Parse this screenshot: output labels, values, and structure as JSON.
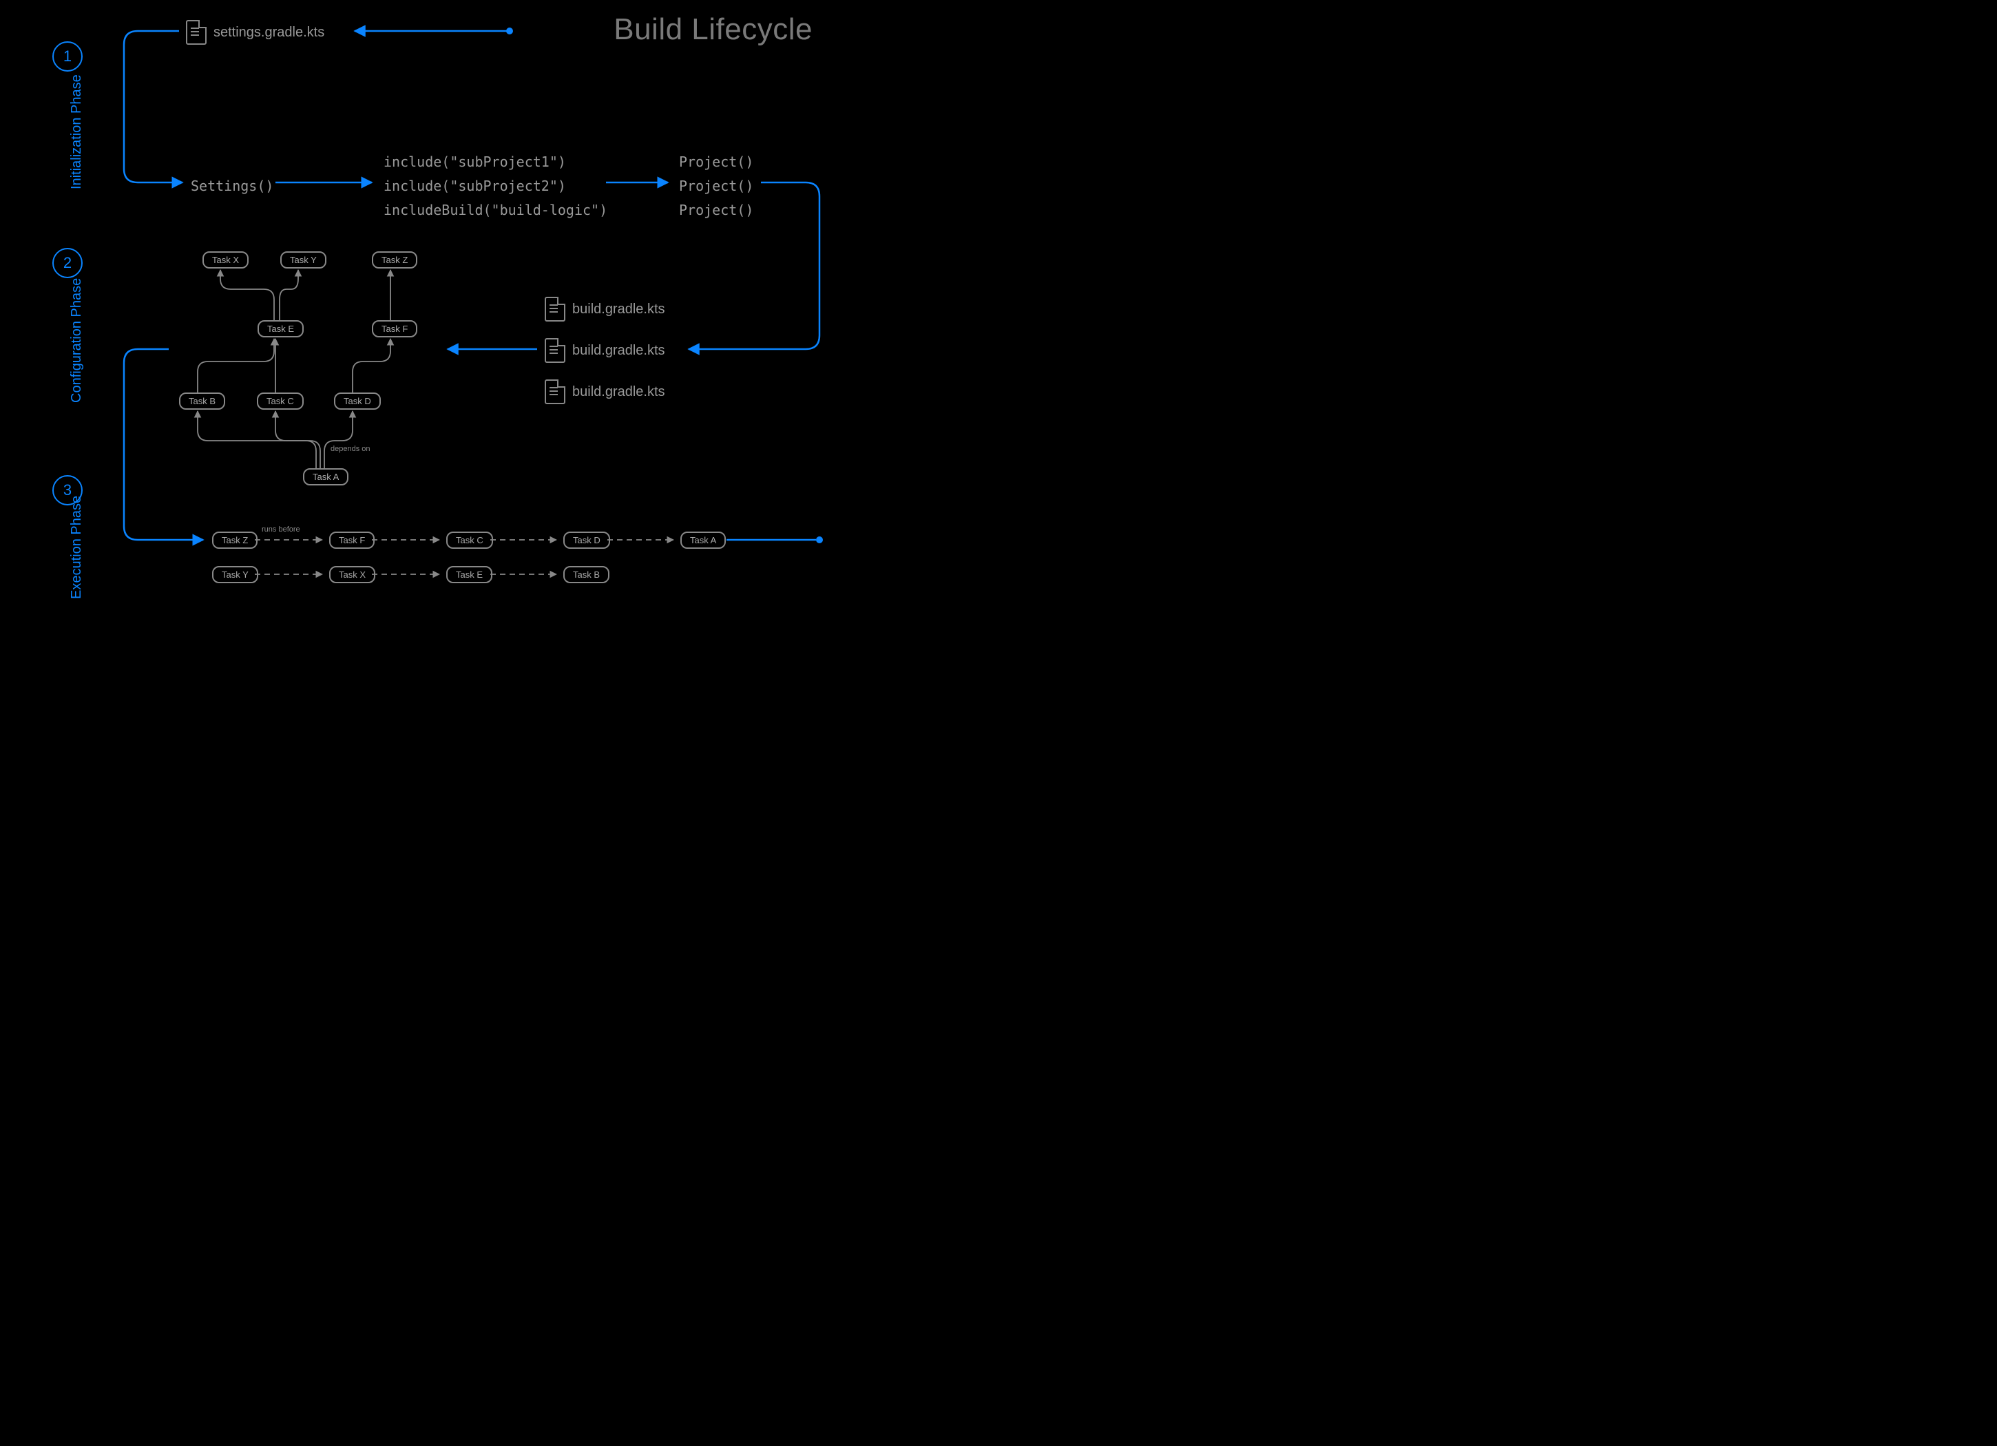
{
  "title": "Build Lifecycle",
  "phases": {
    "p1": {
      "num": "1",
      "label": "Initialization\nPhase"
    },
    "p2": {
      "num": "2",
      "label": "Configuration\nPhase"
    },
    "p3": {
      "num": "3",
      "label": "Execution\nPhase"
    }
  },
  "files": {
    "settings": "settings.gradle.kts",
    "build1": "build.gradle.kts",
    "build2": "build.gradle.kts",
    "build3": "build.gradle.kts"
  },
  "init": {
    "settings_call": "Settings()",
    "includes": "include(\"subProject1\")\ninclude(\"subProject2\")\nincludeBuild(\"build-logic\")",
    "projects": "Project()\nProject()\nProject()"
  },
  "graph": {
    "taskX": "Task X",
    "taskY": "Task Y",
    "taskZ": "Task Z",
    "taskE": "Task E",
    "taskF": "Task F",
    "taskB": "Task B",
    "taskC": "Task C",
    "taskD": "Task D",
    "taskA": "Task A",
    "depends_label": "depends on"
  },
  "exec": {
    "row1": [
      "Task Z",
      "Task F",
      "Task C",
      "Task D",
      "Task A"
    ],
    "row2": [
      "Task Y",
      "Task X",
      "Task E",
      "Task B"
    ],
    "runs_before": "runs before"
  },
  "colors": {
    "accent": "#0a84ff",
    "muted": "#888"
  }
}
